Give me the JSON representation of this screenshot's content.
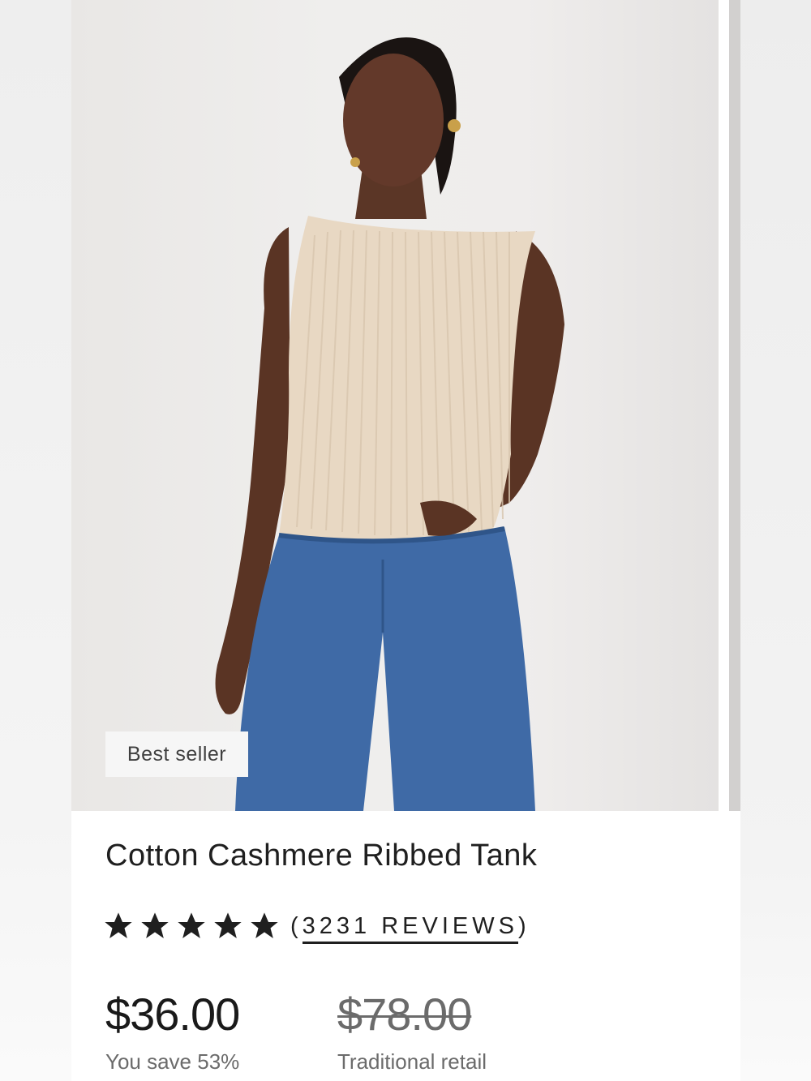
{
  "product": {
    "badge": "Best seller",
    "title": "Cotton Cashmere Ribbed Tank",
    "rating": 5,
    "reviews_label": "3231 REVIEWS",
    "open_paren": "(",
    "close_paren": ")",
    "price": "$36.00",
    "original_price": "$78.00",
    "savings": "You save 53%",
    "original_price_label": "Traditional retail",
    "image_description_icon": "product-photo"
  },
  "colors": {
    "star": "#1f1f1f",
    "text": "#1f1f1f",
    "muted": "#6b6b6b",
    "top": "#e8d8c3",
    "denim": "#3f6aa6"
  }
}
